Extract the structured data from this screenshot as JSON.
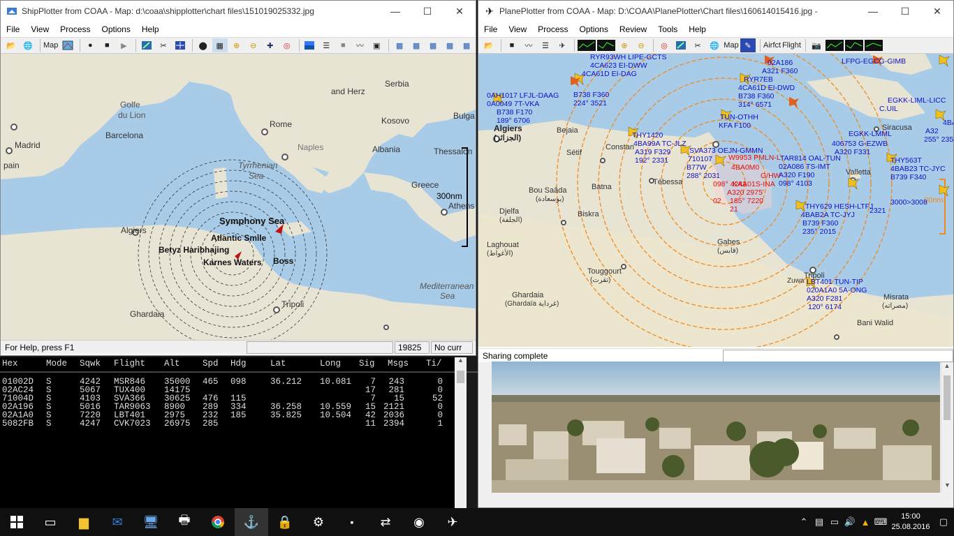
{
  "ship": {
    "title": "ShipPlotter from COAA - Map: d:\\coaa\\shipplotter\\chart files\\151019025332.jpg",
    "menu": [
      "File",
      "View",
      "Process",
      "Options",
      "Help"
    ],
    "toolbar_map_label": "Map",
    "map_labels": {
      "golfe": "Golfe",
      "du_lion": "du Lion",
      "barcelona": "Barcelona",
      "madrid": "Madrid",
      "rome": "Rome",
      "naples": "Naples",
      "tyrrhenian": "Tyrrhenian",
      "sea": "Sea",
      "albania": "Albania",
      "kosovo": "Kosovo",
      "serbia": "Serbia",
      "bulga": "Bulga",
      "thessalon": "Thessalon",
      "greece": "Greece",
      "athens": "Athens",
      "algiers": "Algiers",
      "mediterranean": "Mediterranean",
      "med_sea": "Sea",
      "tripoli": "Tripoli",
      "ghardaia": "Ghardaia",
      "and_herz": "and Herz",
      "spain": "pain",
      "scale": "300nm"
    },
    "vessels": {
      "symphony": "Symphony Sea",
      "atlantic": "Atlantic Smile",
      "cluster_left": "Betyz Haribhajing",
      "cluster_bottom": "Karnes Waters",
      "boss": "Boss"
    },
    "status": {
      "help": "For Help, press F1",
      "count": "19825",
      "curr": "No curr"
    }
  },
  "console": {
    "headers": [
      "Hex",
      "Mode",
      "Sqwk",
      "Flight",
      "Alt",
      "Spd",
      "Hdg",
      "Lat",
      "Long",
      "Sig",
      "Msgs",
      "Ti/"
    ],
    "rows": [
      [
        "01002D",
        "S",
        "4242",
        "MSR846",
        "35000",
        "465",
        "098",
        "36.212",
        "10.081",
        "7",
        "243",
        "0"
      ],
      [
        "02AC24",
        "S",
        "5067",
        "TUX400",
        "14175",
        "",
        "",
        "",
        "",
        "17",
        "281",
        "0"
      ],
      [
        "71004D",
        "S",
        "4103",
        "SVA366",
        "30625",
        "476",
        "115",
        "",
        "",
        "7",
        "15",
        "52"
      ],
      [
        "02A196",
        "S",
        "5016",
        "TAR9063",
        "8900",
        "289",
        "334",
        "36.258",
        "10.559",
        "15",
        "2121",
        "0"
      ],
      [
        "02A1A0",
        "S",
        "7220",
        "LBT401",
        "2975",
        "232",
        "185",
        "35.825",
        "10.504",
        "42",
        "2036",
        "0"
      ],
      [
        "5082FB",
        "S",
        "4247",
        "CVK7023",
        "26975",
        "285",
        "",
        "",
        "",
        "11",
        "2394",
        "1"
      ]
    ]
  },
  "plane": {
    "title": "PlanePlotter from COAA - Map: D:\\COAA\\PlanePlotter\\Chart files\\160614015416.jpg -",
    "menu": [
      "File",
      "View",
      "Process",
      "Options",
      "Review",
      "Tools",
      "Help"
    ],
    "toolbar_map_label": "Map",
    "toolbar_airfct": "Airfct",
    "toolbar_flight": "Flight",
    "map_labels": {
      "algiers": "Algiers",
      "algiers_ar": "(الجزائر)",
      "bejaia": "Bejaia",
      "setif": "Sétif",
      "constantine": "Constan",
      "bou_saada": "Bou Saâda",
      "bou_saada_ar": "(بوسعادة)",
      "batna": "Batna",
      "tebessa": "Tébessa",
      "biskra": "Biskra",
      "djelfa": "Djelfa",
      "djelfa_ar": "(الجلفة)",
      "laghouat": "Laghouat",
      "laghouat_ar": "(الأغواط)",
      "gabes": "Gabes",
      "gabes_ar": "(قابس)",
      "touggourt": "Touggourt",
      "touggourt_ar": "(تقرت)",
      "ghardaia": "Ghardaia",
      "ghardaia_ar": "(Ghardaïa غرداية)",
      "tripoli": "Tripoli",
      "misrata": "Misrata",
      "misrata_ar": "(مصراته)",
      "bani_walid": "Bani Walid",
      "valletta": "Valletta",
      "siracusa": "Siracusa",
      "zuwa": "Zuwa",
      "scale": "00nm"
    },
    "aircraft_blue": [
      "0AH1017 LFJL-DAAG",
      "0A0049 7T-VKA",
      "B738 F170",
      "189° 6706",
      "RYR93WH LIPE-GCTS",
      "4CA623 EI-DWW",
      "4CA61D EI-DAG",
      "B738 F360",
      "224° 3521",
      "02A186",
      "A321 F360",
      "RYR7EB",
      "4CA61D EI-DWD",
      "B738 F360",
      "314° 6571",
      "THY1420",
      "4BA99A TC-JLZ",
      "A319 F329",
      "192° 2331",
      "SVA373 OEJN-GMMN",
      "710107",
      "B77W",
      "288° 2031",
      "TAR814 OAL-TUN",
      "02A086 TS-IMT",
      "A320 F190",
      "098° 4103",
      "THY629 HESH-LTFJ",
      "4BAB2A TC-JYJ",
      "B739 F360",
      "235° 2015",
      "LBT401 TUN-TIP",
      "020A1A0 5A-ONG",
      "A320 F281",
      "120° 6174",
      "THY563T",
      "4BAB23 TC-JYC",
      "B739 F340",
      "EGKK-LMML",
      "406753 G-EZWB",
      "A320 F331",
      "EGKK-LIML-LICC",
      "C.UIL",
      "4BA",
      "A32",
      "255° 235",
      "LFPG-EGCG-GIMB",
      "TUN-OTHH",
      "KFA F100",
      "3000>3008",
      "2321"
    ],
    "aircraft_red": [
      "W9953 PMLN-L",
      "A320 2975'",
      "185° 7220",
      "098° 4242",
      "KAA01S-INA",
      "G/HW",
      "4BA0M0",
      "21",
      "02"
    ],
    "status": "Sharing complete"
  },
  "taskbar": {
    "time": "15:00",
    "date": "25.08.2016",
    "apps": [
      "start",
      "task-view",
      "file-explorer",
      "outlook",
      "remote-desktop",
      "printer",
      "chrome",
      "shipplotter",
      "security",
      "planeplotter-settings",
      "cmd",
      "teamviewer",
      "webcam",
      "planeplotter"
    ]
  },
  "colors": {
    "sea": "#a8cbe8",
    "land": "#e8e4d4",
    "range_ring_ship": "#333333",
    "range_ring_plane": "#f08a1e",
    "aircraft_label_blue": "#1010c8",
    "aircraft_label_red": "#e01010",
    "aircraft_icon": "#f0c020"
  }
}
